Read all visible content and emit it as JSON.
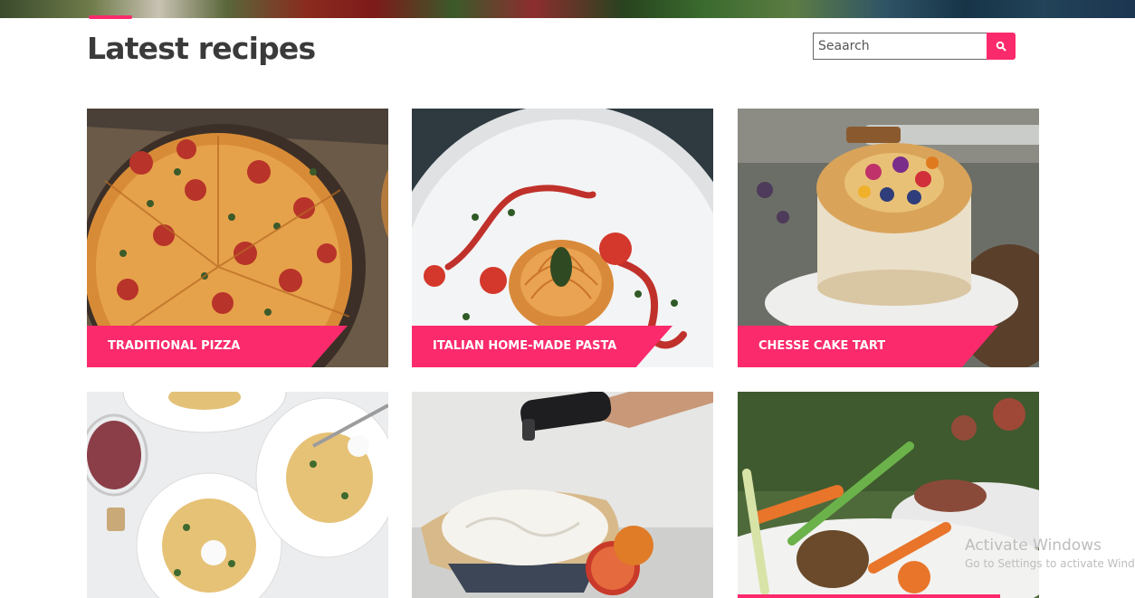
{
  "page": {
    "title": "Latest recipes"
  },
  "search": {
    "placeholder": "Seaarch",
    "icon": "search-icon"
  },
  "accent_color": "#fb2a6c",
  "recipes": [
    {
      "title": "TRADITIONAL PIZZA",
      "image": "pizza-photo"
    },
    {
      "title": "ITALIAN HOME-MADE PASTA",
      "image": "pasta-photo"
    },
    {
      "title": "CHESSE CAKE TART",
      "image": "cheesecake-tart-photo"
    },
    {
      "title": "",
      "image": "spaghetti-plates-photo"
    },
    {
      "title": "",
      "image": "meringue-pie-torch-photo"
    },
    {
      "title": "",
      "image": "roasted-vegetables-plate-photo"
    }
  ],
  "watermark": {
    "title": "Activate Windows",
    "subtitle": "Go to Settings to activate Windows."
  }
}
